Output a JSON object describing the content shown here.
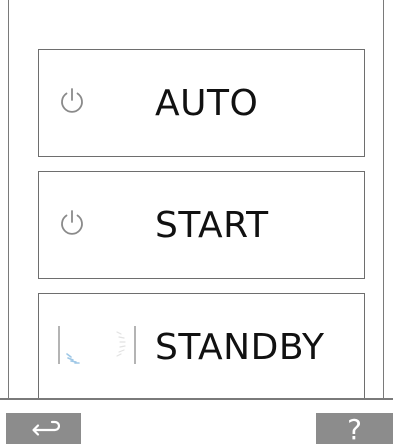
{
  "modes": [
    {
      "label": "AUTO",
      "icon": "power-icon"
    },
    {
      "label": "START",
      "icon": "power-icon"
    },
    {
      "label": "STANDBY",
      "icon": "standby-progress-icon"
    }
  ],
  "footer": {
    "back_icon": "back-arrow-icon",
    "help_label": "?"
  },
  "colors": {
    "frame": "#7a7a7a",
    "button_border": "#6e6e6e",
    "soft_button": "#8c8c8c",
    "label": "#111111",
    "icon": "#8a8a8a"
  }
}
